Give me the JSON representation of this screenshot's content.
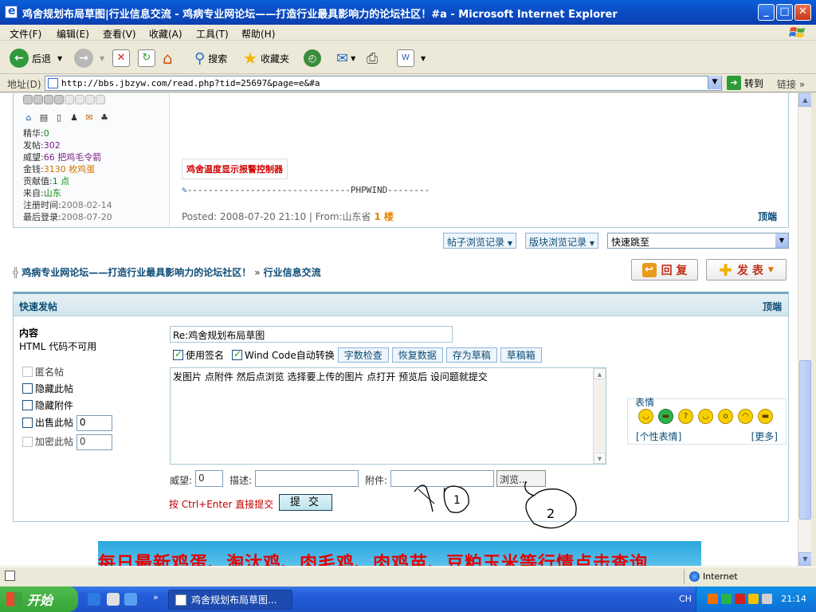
{
  "window": {
    "title": "鸡舍规划布局草图|行业信息交流 - 鸡病专业网论坛——打造行业最具影响力的论坛社区！#a - Microsoft Internet Explorer",
    "minimize": "_",
    "maximize": "□",
    "close": "✕"
  },
  "menu": [
    "文件(F)",
    "编辑(E)",
    "查看(V)",
    "收藏(A)",
    "工具(T)",
    "帮助(H)"
  ],
  "toolbar": {
    "back": "后退",
    "search": "搜索",
    "favorites": "收藏夹"
  },
  "address": {
    "label": "地址(D)",
    "url": "http://bbs.jbzyw.com/read.php?tid=25697&page=e&#a",
    "go": "转到",
    "links": "链接"
  },
  "post": {
    "stats": [
      {
        "k": "精华:",
        "v": "0",
        "cls": "g"
      },
      {
        "k": "发帖:",
        "v": "302",
        "cls": "p"
      },
      {
        "k": "威望:",
        "v": "66 把鸡毛令箭",
        "cls": "p"
      },
      {
        "k": "金钱:",
        "v": "3130 枚鸡蛋",
        "cls": "o"
      },
      {
        "k": "贡献值:",
        "v": "1 点",
        "cls": "g"
      },
      {
        "k": "来自:",
        "v": "山东",
        "cls": "g"
      },
      {
        "k": "注册时间:",
        "v": "2008-02-14",
        "cls": "gr"
      },
      {
        "k": "最后登录:",
        "v": "2008-07-20",
        "cls": "gr"
      }
    ],
    "signature_tag": "鸡舍温度显示报警控制器",
    "phpwind_line": "-------------------------------PHPWIND--------",
    "posted": "Posted: 2008-07-20 21:10",
    "from": "From:山东省",
    "floor": "1 楼",
    "top_link": "顶端"
  },
  "records": {
    "thread_history": "帖子浏览记录",
    "board_history": "版块浏览记录",
    "quick_jump": "快速跳至"
  },
  "breadcrumb": {
    "forum": "鸡病专业网论坛——打造行业最具影响力的论坛社区！",
    "sep": "»",
    "board": "行业信息交流"
  },
  "actions": {
    "reply": "回 复",
    "post": "发 表"
  },
  "quickpost": {
    "title": "快速发帖",
    "top_link": "顶端",
    "content_label": "内容",
    "html_note": "HTML 代码不可用",
    "anonymous": "匿名帖",
    "hide_post": "隐藏此帖",
    "hide_attach": "隐藏附件",
    "sell_post": "出售此帖",
    "sell_value": "0",
    "encrypt_post": "加密此帖",
    "encrypt_value": "0",
    "subject": "Re:鸡舍规划布局草图",
    "use_signature": "使用签名",
    "windcode": "Wind Code自动转换",
    "btn_count": "字数检查",
    "btn_restore": "恢复数据",
    "btn_draft": "存为草稿",
    "btn_drafts": "草稿箱",
    "body": "发图片   点附件    然后点浏览   选择要上传的图片 点打开     预览后 设问题就提交",
    "emoticons_label": "表情",
    "custom_emo": "[个性表情]",
    "more_emo": "[更多]",
    "prestige_label": "威望:",
    "prestige_value": "0",
    "desc_label": "描述:",
    "attach_label": "附件:",
    "browse": "浏览...",
    "hint": "按 Ctrl+Enter 直接提交",
    "submit": "提 交"
  },
  "banner": {
    "text": "每日最新鸡蛋、淘汰鸡、肉毛鸡、肉鸡苗、豆粕玉米等行情点击查询"
  },
  "annotations": {
    "circle1": "1",
    "circle2": "2"
  },
  "status": {
    "zone": "Internet"
  },
  "taskbar": {
    "start": "开始",
    "task": "鸡舍规划布局草图...",
    "lang": "CH",
    "clock": "21:14"
  }
}
